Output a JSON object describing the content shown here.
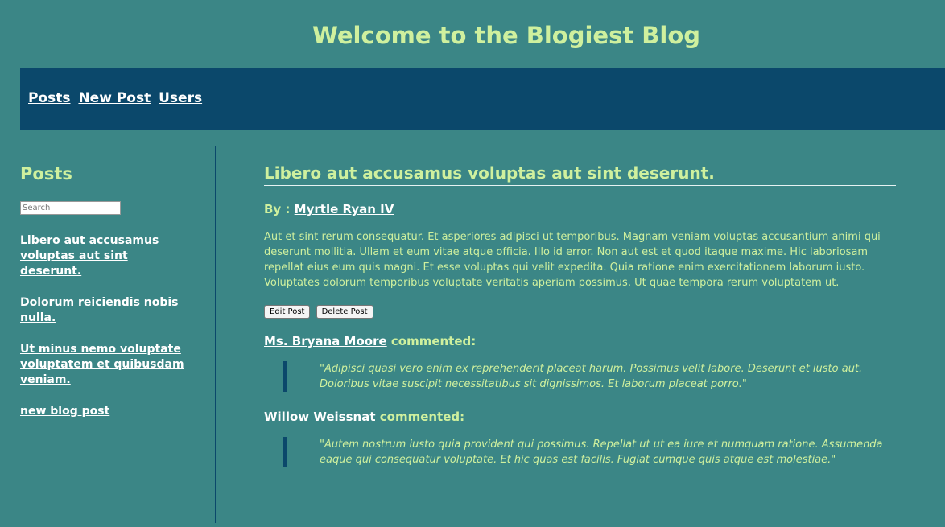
{
  "site": {
    "title": "Welcome to the Blogiest Blog"
  },
  "nav": {
    "items": [
      "Posts",
      "New Post",
      "Users"
    ]
  },
  "sidebar": {
    "title": "Posts",
    "search_placeholder": "Search",
    "posts": [
      "Libero aut accusamus voluptas aut sint deserunt.",
      "Dolorum reiciendis nobis nulla.",
      "Ut minus nemo voluptate voluptatem et quibusdam veniam."
    ],
    "new_post_link": "new blog post"
  },
  "post": {
    "title": "Libero aut accusamus voluptas aut sint deserunt.",
    "by_label": "By :",
    "author": "Myrtle Ryan IV",
    "body": "Aut et sint rerum consequatur. Et asperiores adipisci ut temporibus. Magnam veniam voluptas accusantium animi qui deserunt mollitia. Ullam et eum vitae atque officia. Illo id error. Non aut est et quod itaque maxime. Hic laboriosam repellat eius eum quis magni. Et esse voluptas qui velit expedita. Quia ratione enim exercitationem laborum iusto. Voluptates dolorum temporibus voluptate veritatis aperiam possimus. Ut quae tempora rerum voluptatem ut.",
    "edit_label": "Edit Post",
    "delete_label": "Delete Post"
  },
  "comments": [
    {
      "author": "Ms. Bryana Moore",
      "verb": "commented:",
      "text": "\"Adipisci quasi vero enim ex reprehenderit placeat harum. Possimus velit labore. Deserunt et iusto aut. Doloribus vitae suscipit necessitatibus sit dignissimos. Et laborum placeat porro.\""
    },
    {
      "author": "Willow Weissnat",
      "verb": "commented:",
      "text": "\"Autem nostrum iusto quia provident qui possimus. Repellat ut ut ea iure et numquam ratione. Assumenda eaque qui consequatur voluptate. Et hic quas est facilis. Fugiat cumque quis atque est molestiae.\""
    }
  ],
  "colors": {
    "background": "#3b8686",
    "nav_background": "#0b486b",
    "accent_text": "#cff09e",
    "link": "#ffffff"
  }
}
